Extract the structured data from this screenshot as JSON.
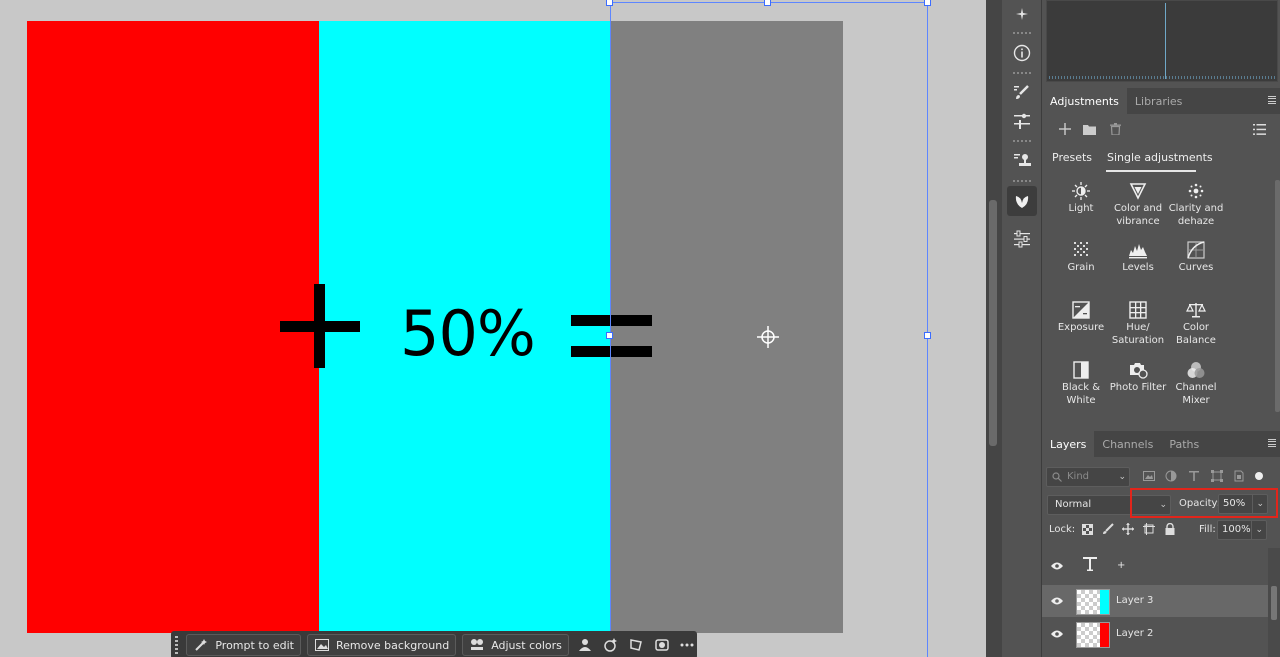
{
  "canvas": {
    "equation_text": "50%",
    "colors": {
      "red": "#ff0000",
      "cyan": "#00ffff",
      "gray": "#808080"
    }
  },
  "taskbar": {
    "prompt_label": "Prompt to edit",
    "remove_bg_label": "Remove background",
    "adjust_colors_label": "Adjust colors"
  },
  "adjustments": {
    "tabs": [
      "Adjustments",
      "Libraries"
    ],
    "subtabs": [
      "Presets",
      "Single adjustments"
    ],
    "items": [
      {
        "label_1": "Light",
        "label_2": "",
        "icon": "sun-icon"
      },
      {
        "label_1": "Color and",
        "label_2": "vibrance",
        "icon": "triangle-icon"
      },
      {
        "label_1": "Clarity and",
        "label_2": "dehaze",
        "icon": "sparkle-icon"
      },
      {
        "label_1": "Grain",
        "label_2": "",
        "icon": "grain-icon"
      },
      {
        "label_1": "Levels",
        "label_2": "",
        "icon": "levels-icon"
      },
      {
        "label_1": "Curves",
        "label_2": "",
        "icon": "curves-icon"
      },
      {
        "label_1": "Exposure",
        "label_2": "",
        "icon": "exposure-icon"
      },
      {
        "label_1": "Hue/",
        "label_2": "Saturation",
        "icon": "hue-saturation-icon"
      },
      {
        "label_1": "Color",
        "label_2": "Balance",
        "icon": "balance-icon"
      },
      {
        "label_1": "Black &",
        "label_2": "White",
        "icon": "black-white-icon"
      },
      {
        "label_1": "Photo Filter",
        "label_2": "",
        "icon": "camera-icon"
      },
      {
        "label_1": "Channel",
        "label_2": "Mixer",
        "icon": "channel-mixer-icon"
      }
    ]
  },
  "layers": {
    "tabs": [
      "Layers",
      "Channels",
      "Paths"
    ],
    "kind_placeholder": "Kind",
    "blend_mode": "Normal",
    "opacity_label": "Opacity:",
    "opacity_value": "50%",
    "lock_label": "Lock:",
    "fill_label": "Fill:",
    "fill_value": "100%",
    "rows": [
      {
        "name": "",
        "type": "text",
        "extra": "+"
      },
      {
        "name": "Layer 3",
        "type": "pixel",
        "selected": true,
        "swatch": "#00ffff"
      },
      {
        "name": "Layer 2",
        "type": "pixel",
        "selected": false,
        "swatch": "#ff0000"
      }
    ]
  }
}
